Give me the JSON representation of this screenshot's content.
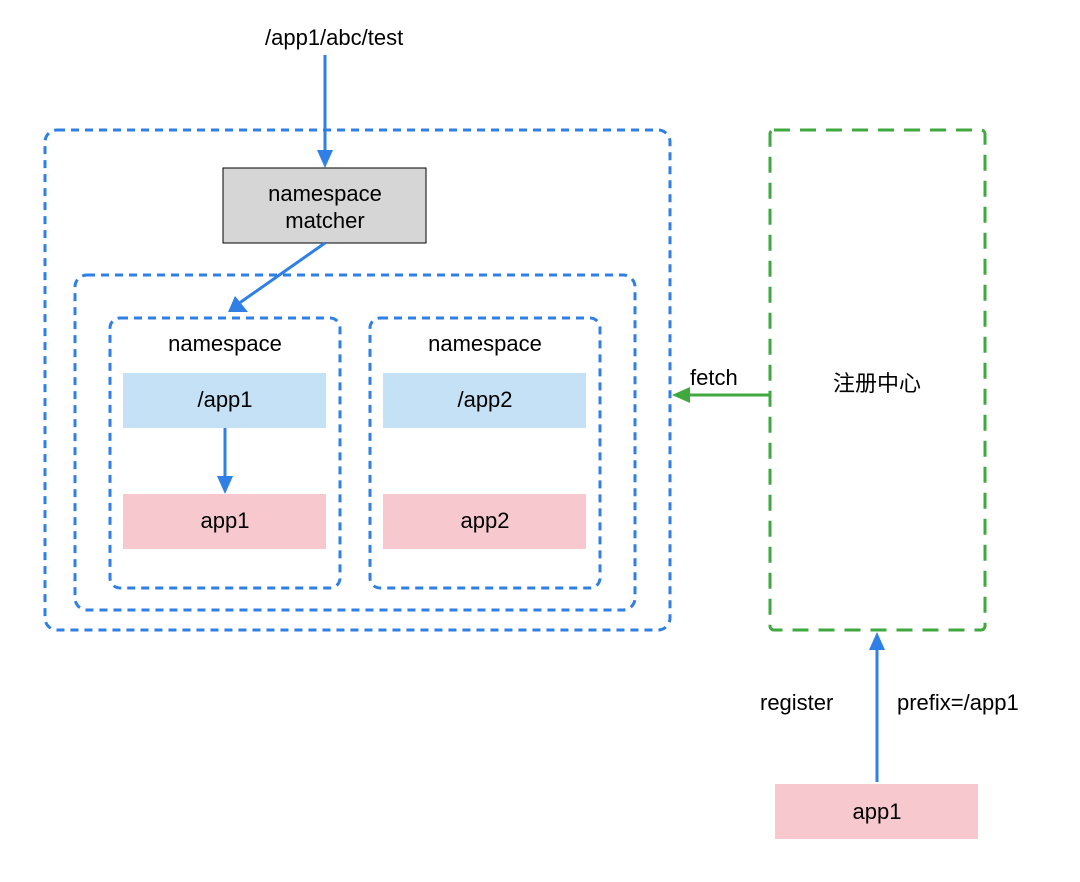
{
  "top_label": "/app1/abc/test",
  "matcher": {
    "line1": "namespace",
    "line2": "matcher"
  },
  "namespaces": [
    {
      "title": "namespace",
      "path": "/app1",
      "app": "app1"
    },
    {
      "title": "namespace",
      "path": "/app2",
      "app": "app2"
    }
  ],
  "registry_label": "注册中心",
  "fetch_label": "fetch",
  "register_label": "register",
  "prefix_label": "prefix=/app1",
  "bottom_app": "app1",
  "colors": {
    "blue_stroke": "#2f7fe6",
    "green_stroke": "#3fa93f",
    "grey_fill": "#d6d6d6",
    "light_blue_fill": "#c4e1f5",
    "pink_fill": "#f7c9cf",
    "arrow_blue": "#2f7fe6",
    "arrow_green": "#3fa93f"
  }
}
